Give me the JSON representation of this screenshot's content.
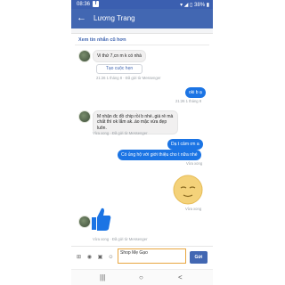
{
  "status_bar": {
    "time": "08:36",
    "app_icon": "f",
    "right_text": "▾ ◢ ▯ 38% ▮"
  },
  "header": {
    "back_icon": "arrow-left-icon",
    "title": "Lương Trang"
  },
  "older_messages_link": "Xem tin nhắn cũ hơn",
  "messages": [
    {
      "side": "in",
      "text": "Vi thứ 7,cn m k có nhà"
    },
    {
      "quick_reply": "Tạo cuộc hẹn"
    },
    {
      "meta_in_1": "21:26 1 tháng 8 · Đã gửi từ Messenger"
    },
    {
      "side": "out",
      "text": "oki b ạ"
    },
    {
      "meta_out_1": "21:26 1 tháng 8"
    },
    {
      "side": "in",
      "text": "M nhận đc đồ chip rồi b nhé..giá rẻ mà chất thì ok lắm ak..áo mặc vừa đẹp luôn."
    },
    {
      "meta_in_2": "Vừa xong · Đã gửi từ Messenger"
    },
    {
      "side": "out",
      "text": "Dạ t cảm ơn a"
    },
    {
      "side": "out",
      "text": "Có ủng hộ với giới thiệu cho t nữa nhé"
    },
    {
      "meta_out_2": "Vừa xong"
    },
    {
      "meta_out_3": "Vừa xong"
    },
    {
      "meta_in_3": "Vừa xong · Đã gửi từ Messenger"
    }
  ],
  "composer": {
    "input_value": "Shop Mẹ Gạo",
    "send_label": "Gửi"
  },
  "nav": {
    "recent": "|||",
    "home": "○",
    "back": "<"
  },
  "colors": {
    "accent": "#4267b2",
    "outgoing": "#1b74e4",
    "input_border": "#e8a640"
  }
}
